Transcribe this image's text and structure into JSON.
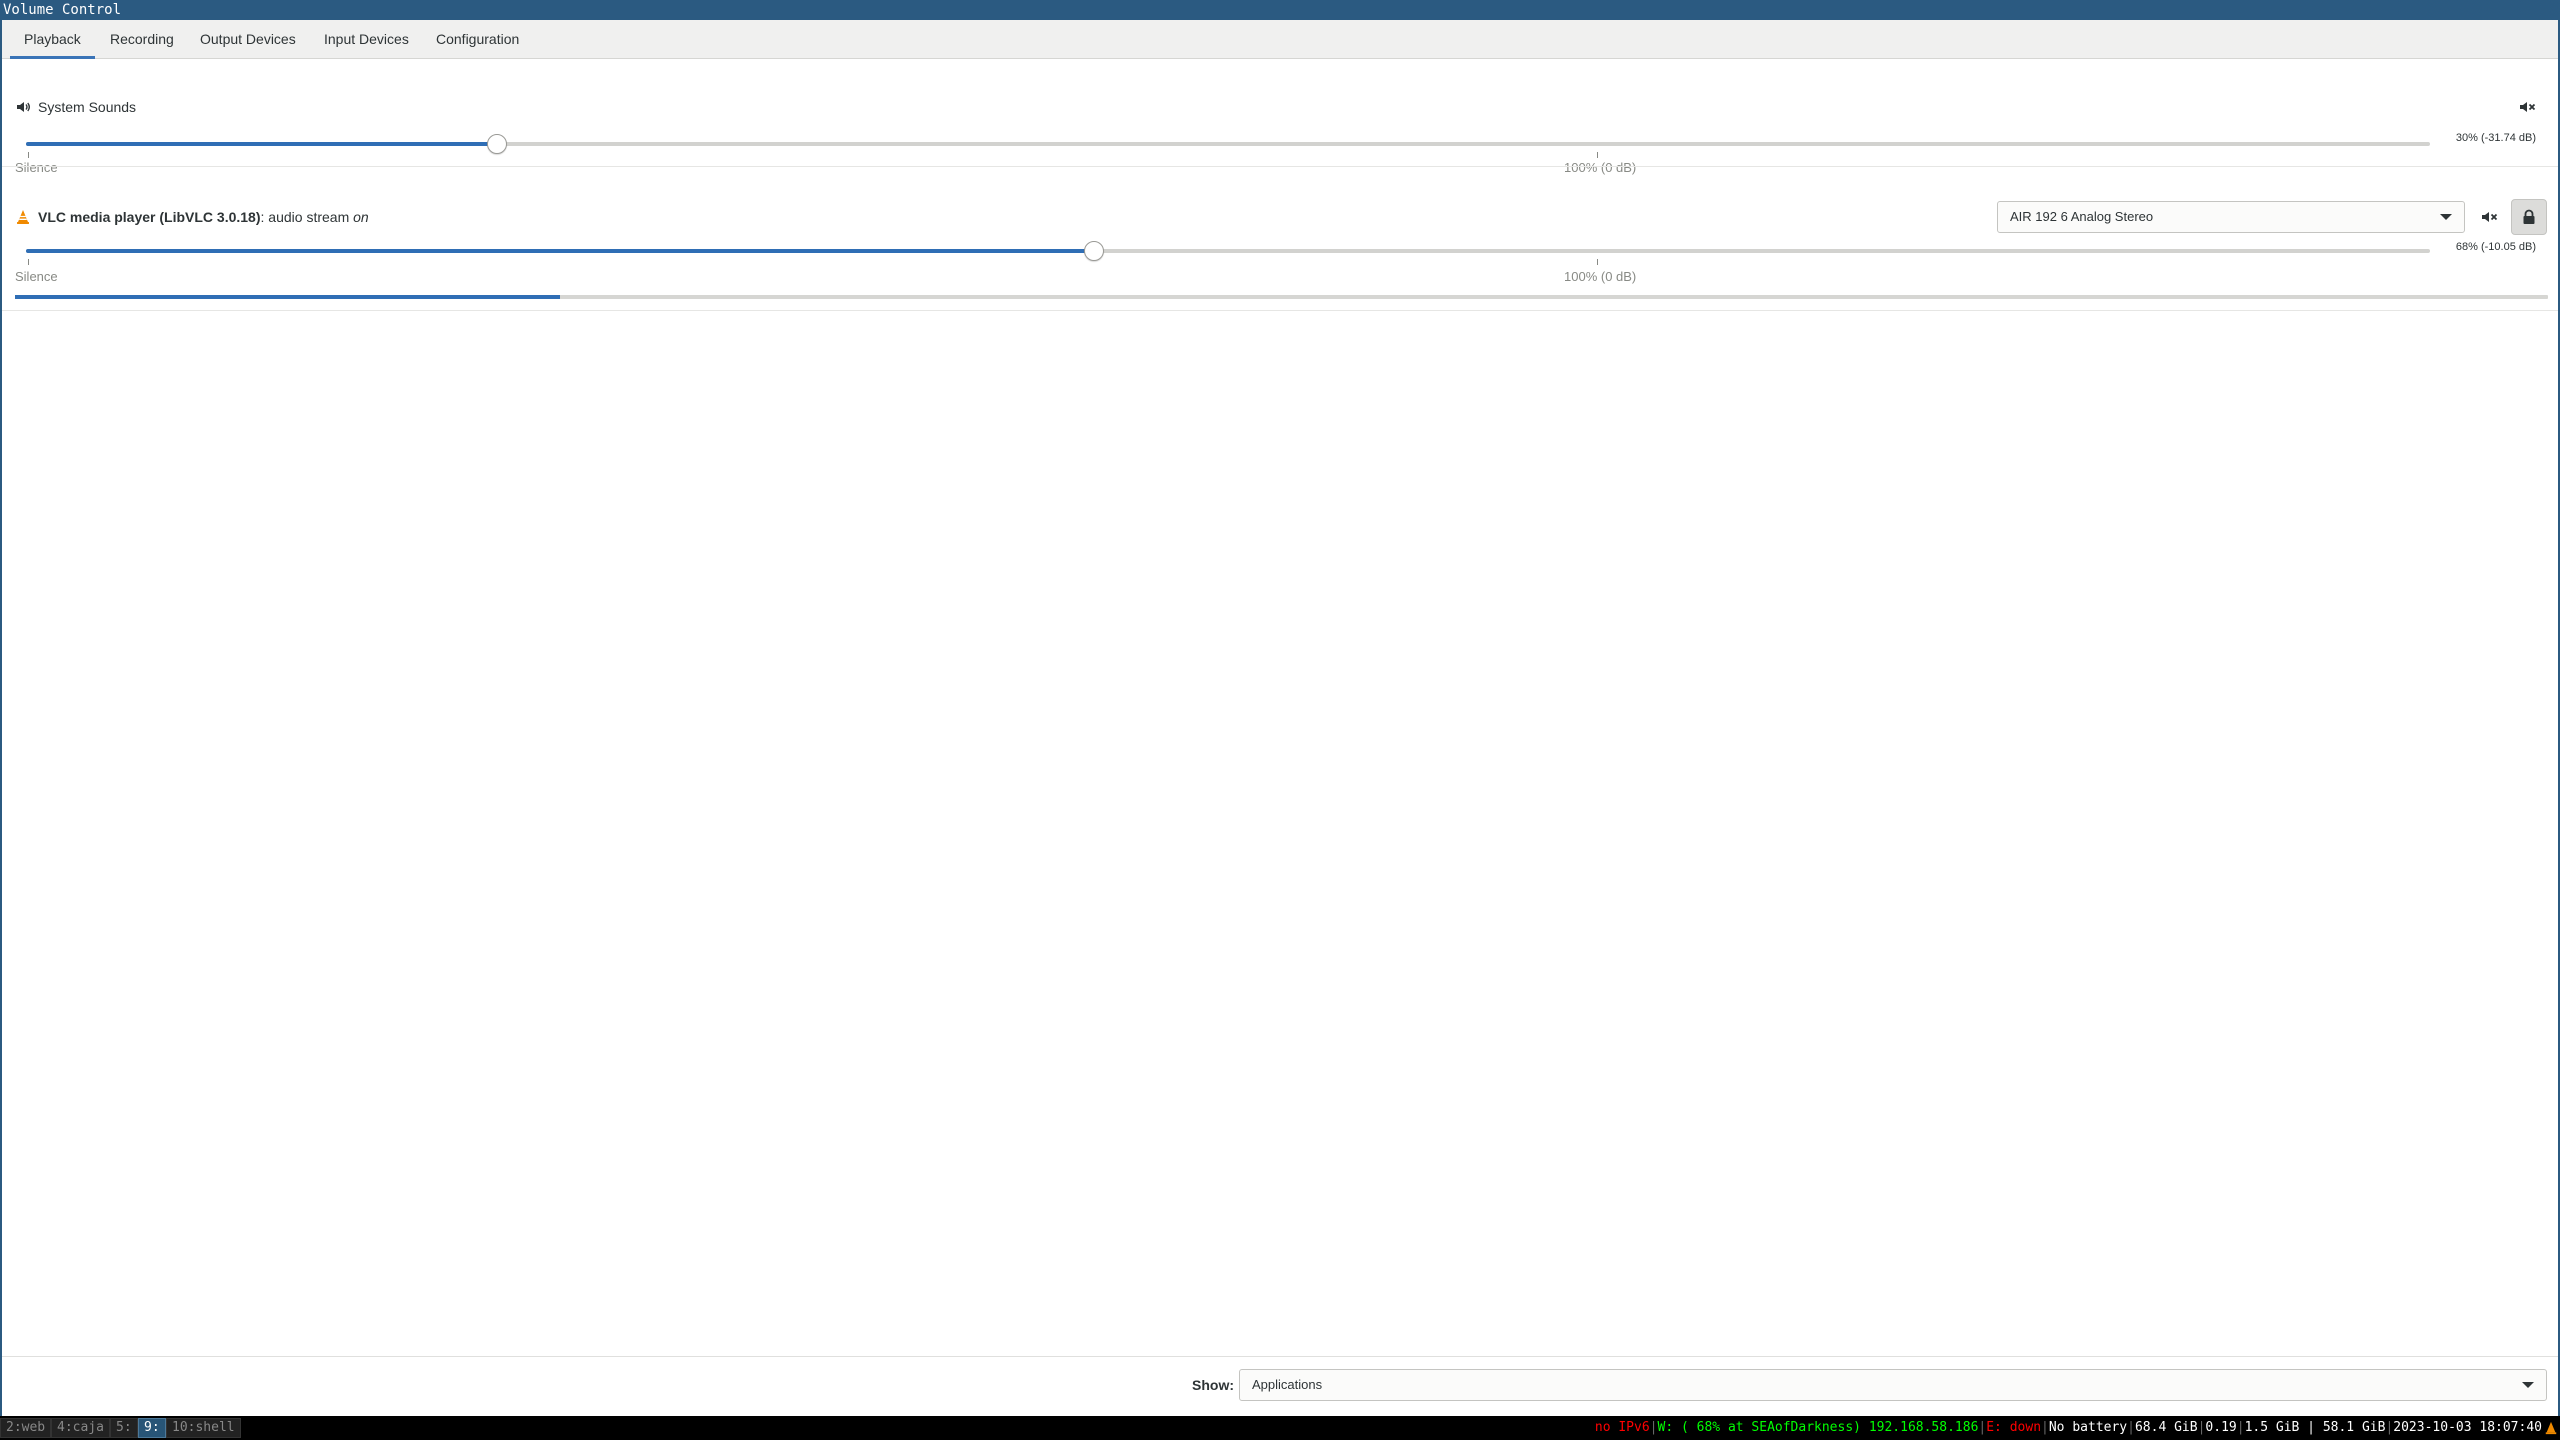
{
  "window": {
    "title": "Volume Control"
  },
  "tabs": [
    {
      "label": "Playback",
      "active": true
    },
    {
      "label": "Recording",
      "active": false
    },
    {
      "label": "Output Devices",
      "active": false
    },
    {
      "label": "Input Devices",
      "active": false
    },
    {
      "label": "Configuration",
      "active": false
    }
  ],
  "streams": [
    {
      "name": "System Sounds",
      "icon": "speaker-icon",
      "volume_fraction": 0.3,
      "volume_readout": "30% (-31.74 dB)",
      "silence_label": "Silence",
      "unity_label": "100% (0 dB)"
    },
    {
      "app": "VLC media player (LibVLC 3.0.18)",
      "separator": ": ",
      "stream": "audio stream",
      "on_label": "on",
      "icon": "vlc-cone-icon",
      "device": "AIR 192 6 Analog Stereo",
      "volume_fraction": 0.68,
      "volume_readout": "68% (-10.05 dB)",
      "silence_label": "Silence",
      "unity_label": "100% (0 dB)",
      "peak_fraction": 0.215
    }
  ],
  "bottom": {
    "show_label": "Show:",
    "show_value": "Applications"
  },
  "taskbar": {
    "workspaces": [
      {
        "label": "2:web",
        "focused": false
      },
      {
        "label": "4:caja",
        "focused": false
      },
      {
        "label": "5:",
        "focused": false
      },
      {
        "label": "9:",
        "focused": true
      },
      {
        "label": "10:shell",
        "focused": false
      }
    ],
    "status": {
      "ipv6": "no IPv6",
      "wifi": "W: ( 68% at SEAofDarkness) 192.168.58.186",
      "ethernet": "E: down",
      "battery": "No battery",
      "disk": "68.4 GiB",
      "load": "0.19",
      "memory": "1.5 GiB | 58.1 GiB",
      "datetime": "2023-10-03 18:07:40"
    }
  },
  "colors": {
    "accent": "#2f6eb5",
    "titlebar": "#2b5a81",
    "status_red": "#ff0000",
    "status_green": "#00ff00"
  }
}
